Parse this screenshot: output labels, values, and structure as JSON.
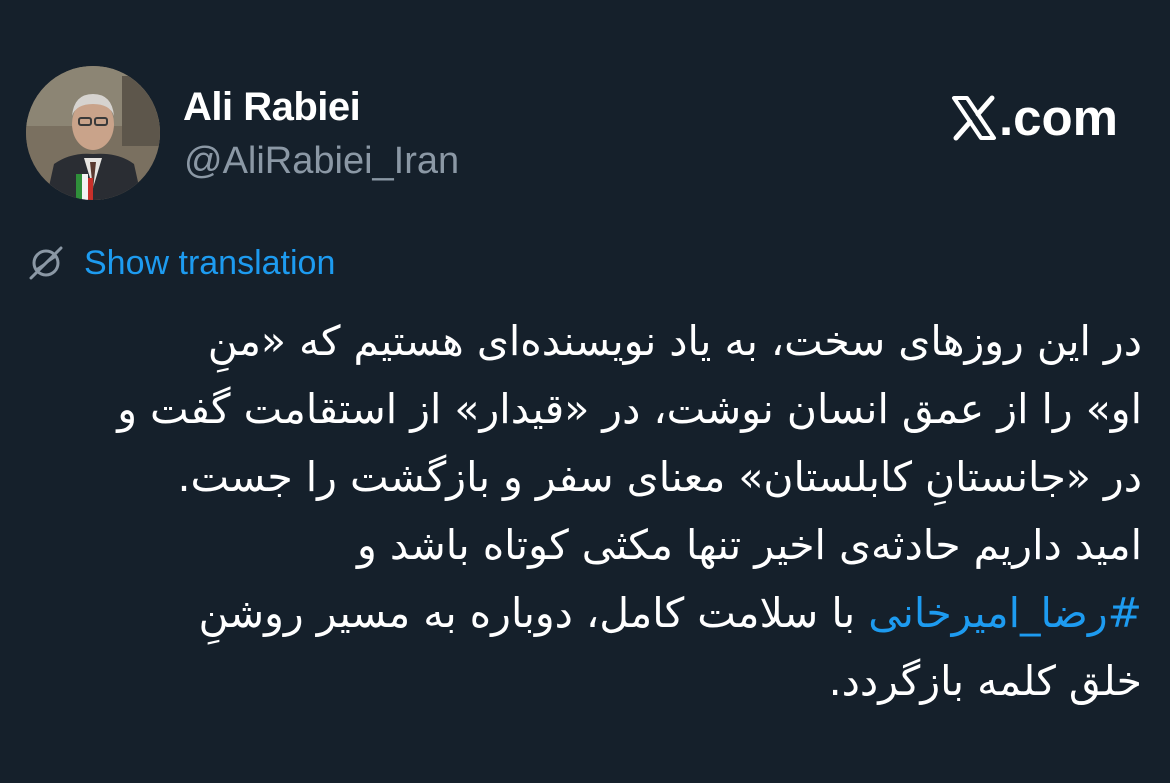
{
  "author": {
    "display_name": "Ali Rabiei",
    "handle": "@AliRabiei_Iran",
    "avatar_icon": "profile-photo"
  },
  "site": {
    "brand_suffix": ".com",
    "brand_icon": "x-logo-icon"
  },
  "translate": {
    "label": "Show translation",
    "icon": "translate-icon"
  },
  "tweet": {
    "lines": [
      "در این روزهای سخت، به یاد نویسنده‌ای هستیم که «منِ",
      "او» را از عمق انسان نوشت، در «قیدار» از استقامت گفت و",
      "در «جانستانِ کابلستان» معنای سفر و بازگشت را جست.",
      "امید داریم حادثه‌ی اخیر تنها مکثی کوتاه باشد و"
    ],
    "hashtag": "#رضا_امیرخانی",
    "hashtag_line_rest": " با سلامت کامل، دوباره به مسیر روشنِ",
    "last_line": "خلق کلمه بازگردد."
  },
  "colors": {
    "background": "#15202b",
    "link": "#1d9bf0",
    "secondary_text": "#8b98a5",
    "primary_text": "#ffffff"
  }
}
